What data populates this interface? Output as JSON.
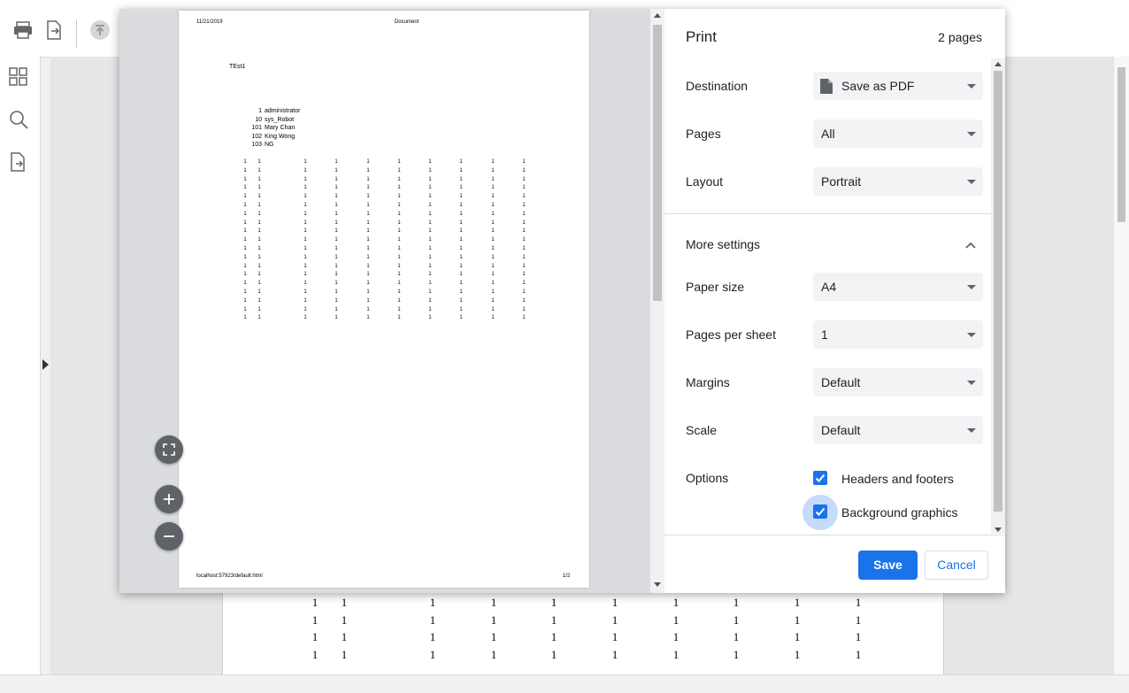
{
  "dialog": {
    "title": "Print",
    "page_count": "2 pages",
    "destination": {
      "label": "Destination",
      "value": "Save as PDF"
    },
    "pages": {
      "label": "Pages",
      "value": "All"
    },
    "layout": {
      "label": "Layout",
      "value": "Portrait"
    },
    "more_settings": {
      "label": "More settings",
      "expanded": true
    },
    "paper_size": {
      "label": "Paper size",
      "value": "A4"
    },
    "pages_per_sheet": {
      "label": "Pages per sheet",
      "value": "1"
    },
    "margins": {
      "label": "Margins",
      "value": "Default"
    },
    "scale": {
      "label": "Scale",
      "value": "Default"
    },
    "options": {
      "label": "Options",
      "headers_footers": {
        "label": "Headers and footers",
        "checked": true
      },
      "background_graphics": {
        "label": "Background graphics",
        "checked": true
      }
    },
    "save_label": "Save",
    "cancel_label": "Cancel"
  },
  "preview": {
    "header_date": "11/21/2019",
    "header_title": "Document",
    "doc_title": "TEst1",
    "users": [
      {
        "id": "1",
        "name": "administrator"
      },
      {
        "id": "10",
        "name": "sys_Robot"
      },
      {
        "id": "101",
        "name": "Mary Chan"
      },
      {
        "id": "102",
        "name": "King Wong"
      },
      {
        "id": "103",
        "name": "NG"
      }
    ],
    "grid_value": "1",
    "grid_rows": 19,
    "footer_url": "localhost:57923/default.html",
    "footer_page": "1/2"
  },
  "background_page": {
    "cell_value": "1",
    "rows": 4
  },
  "colors": {
    "accent": "#1a73e8",
    "checkbox_halo": "#c6dafc",
    "select_bg": "#f1f3f4",
    "preview_bg": "#dadce0"
  },
  "icons": [
    "print-icon",
    "export-icon",
    "upload-icon",
    "thumbnails-icon",
    "search-icon",
    "document-icon",
    "file-icon",
    "fullscreen-icon",
    "zoom-in-icon",
    "zoom-out-icon",
    "chevron-up-icon",
    "dropdown-arrow-icon",
    "checkmark-icon"
  ]
}
